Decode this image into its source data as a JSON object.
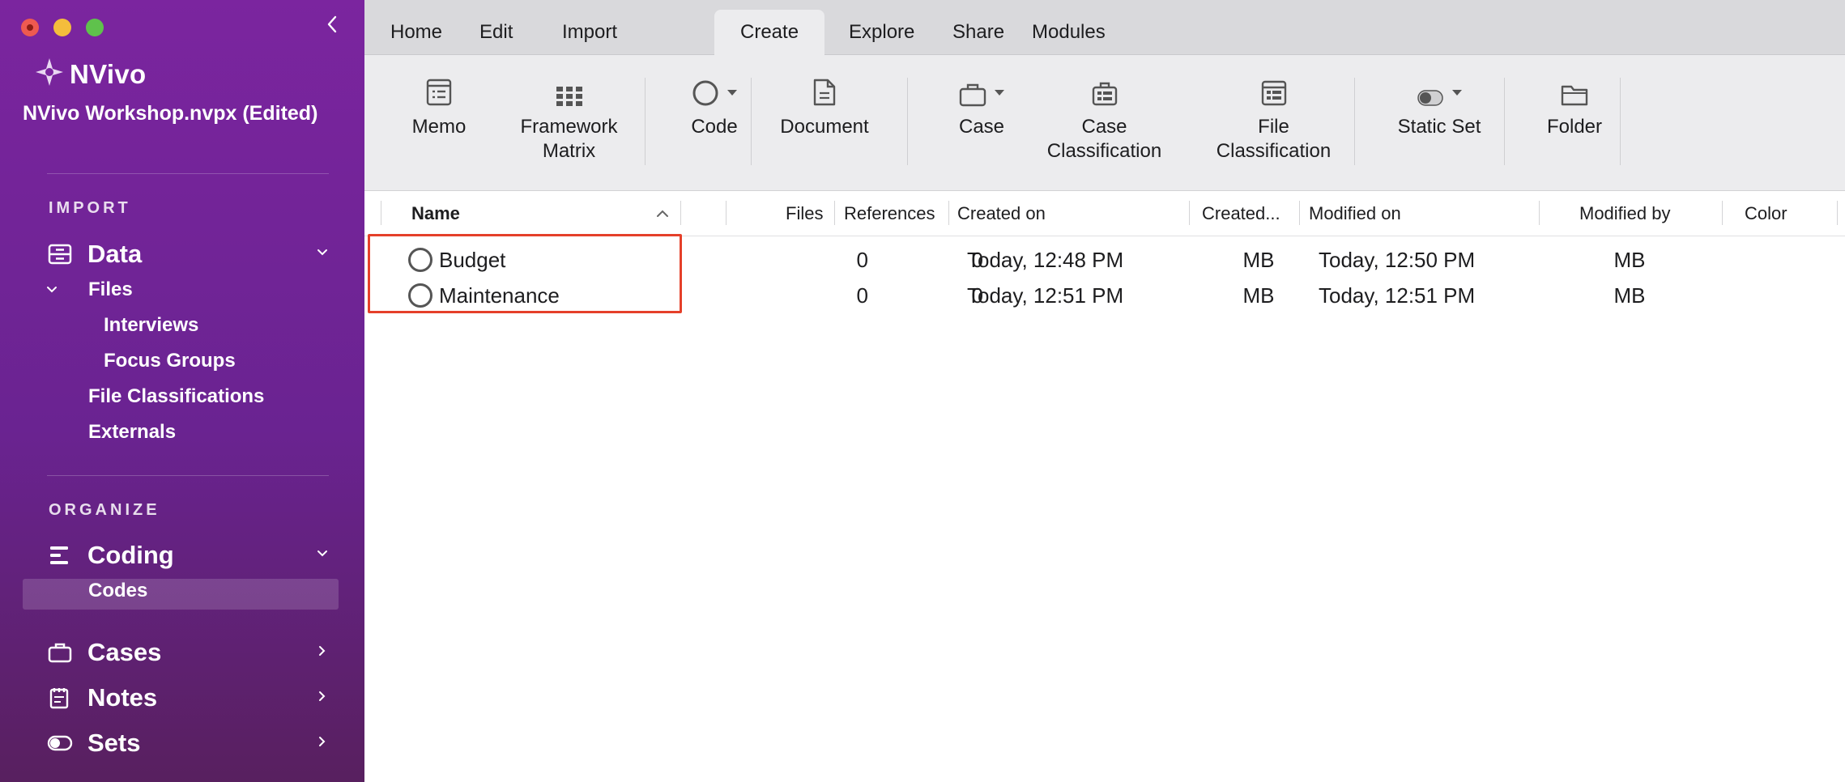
{
  "app": {
    "name": "NVivo",
    "project_title": "NVivo Workshop.nvpx (Edited)"
  },
  "sidebar": {
    "import_label": "IMPORT",
    "organize_label": "ORGANIZE",
    "data_label": "Data",
    "files_label": "Files",
    "interviews_label": "Interviews",
    "focus_groups_label": "Focus Groups",
    "file_classifications_label": "File Classifications",
    "externals_label": "Externals",
    "coding_label": "Coding",
    "codes_label": "Codes",
    "cases_label": "Cases",
    "notes_label": "Notes",
    "sets_label": "Sets"
  },
  "tabs": [
    {
      "label": "Home"
    },
    {
      "label": "Edit"
    },
    {
      "label": "Import"
    },
    {
      "label": "Create",
      "active": true
    },
    {
      "label": "Explore"
    },
    {
      "label": "Share"
    },
    {
      "label": "Modules"
    }
  ],
  "ribbon": {
    "memo": "Memo",
    "framework_matrix": "Framework Matrix",
    "code": "Code",
    "document": "Document",
    "case": "Case",
    "case_classification": "Case Classification",
    "file_classification": "File Classification",
    "static_set": "Static Set",
    "folder": "Folder"
  },
  "table": {
    "columns": {
      "name": "Name",
      "files": "Files",
      "references": "References",
      "created_on": "Created on",
      "created_by": "Created...",
      "modified_on": "Modified on",
      "modified_by": "Modified by",
      "color": "Color"
    },
    "rows": [
      {
        "name": "Budget",
        "files": "0",
        "references": "0",
        "created_on": "Today, 12:48 PM",
        "created_by": "MB",
        "modified_on": "Today, 12:50 PM",
        "modified_by": "MB"
      },
      {
        "name": "Maintenance",
        "files": "0",
        "references": "0",
        "created_on": "Today, 12:51 PM",
        "created_by": "MB",
        "modified_on": "Today, 12:51 PM",
        "modified_by": "MB"
      }
    ]
  },
  "colors": {
    "sidebar_top": "#7b259f",
    "sidebar_bottom": "#58205f",
    "highlight_border": "#e5402a",
    "ribbon_bg": "#ececee",
    "tabbar_bg": "#d9d9dc"
  }
}
